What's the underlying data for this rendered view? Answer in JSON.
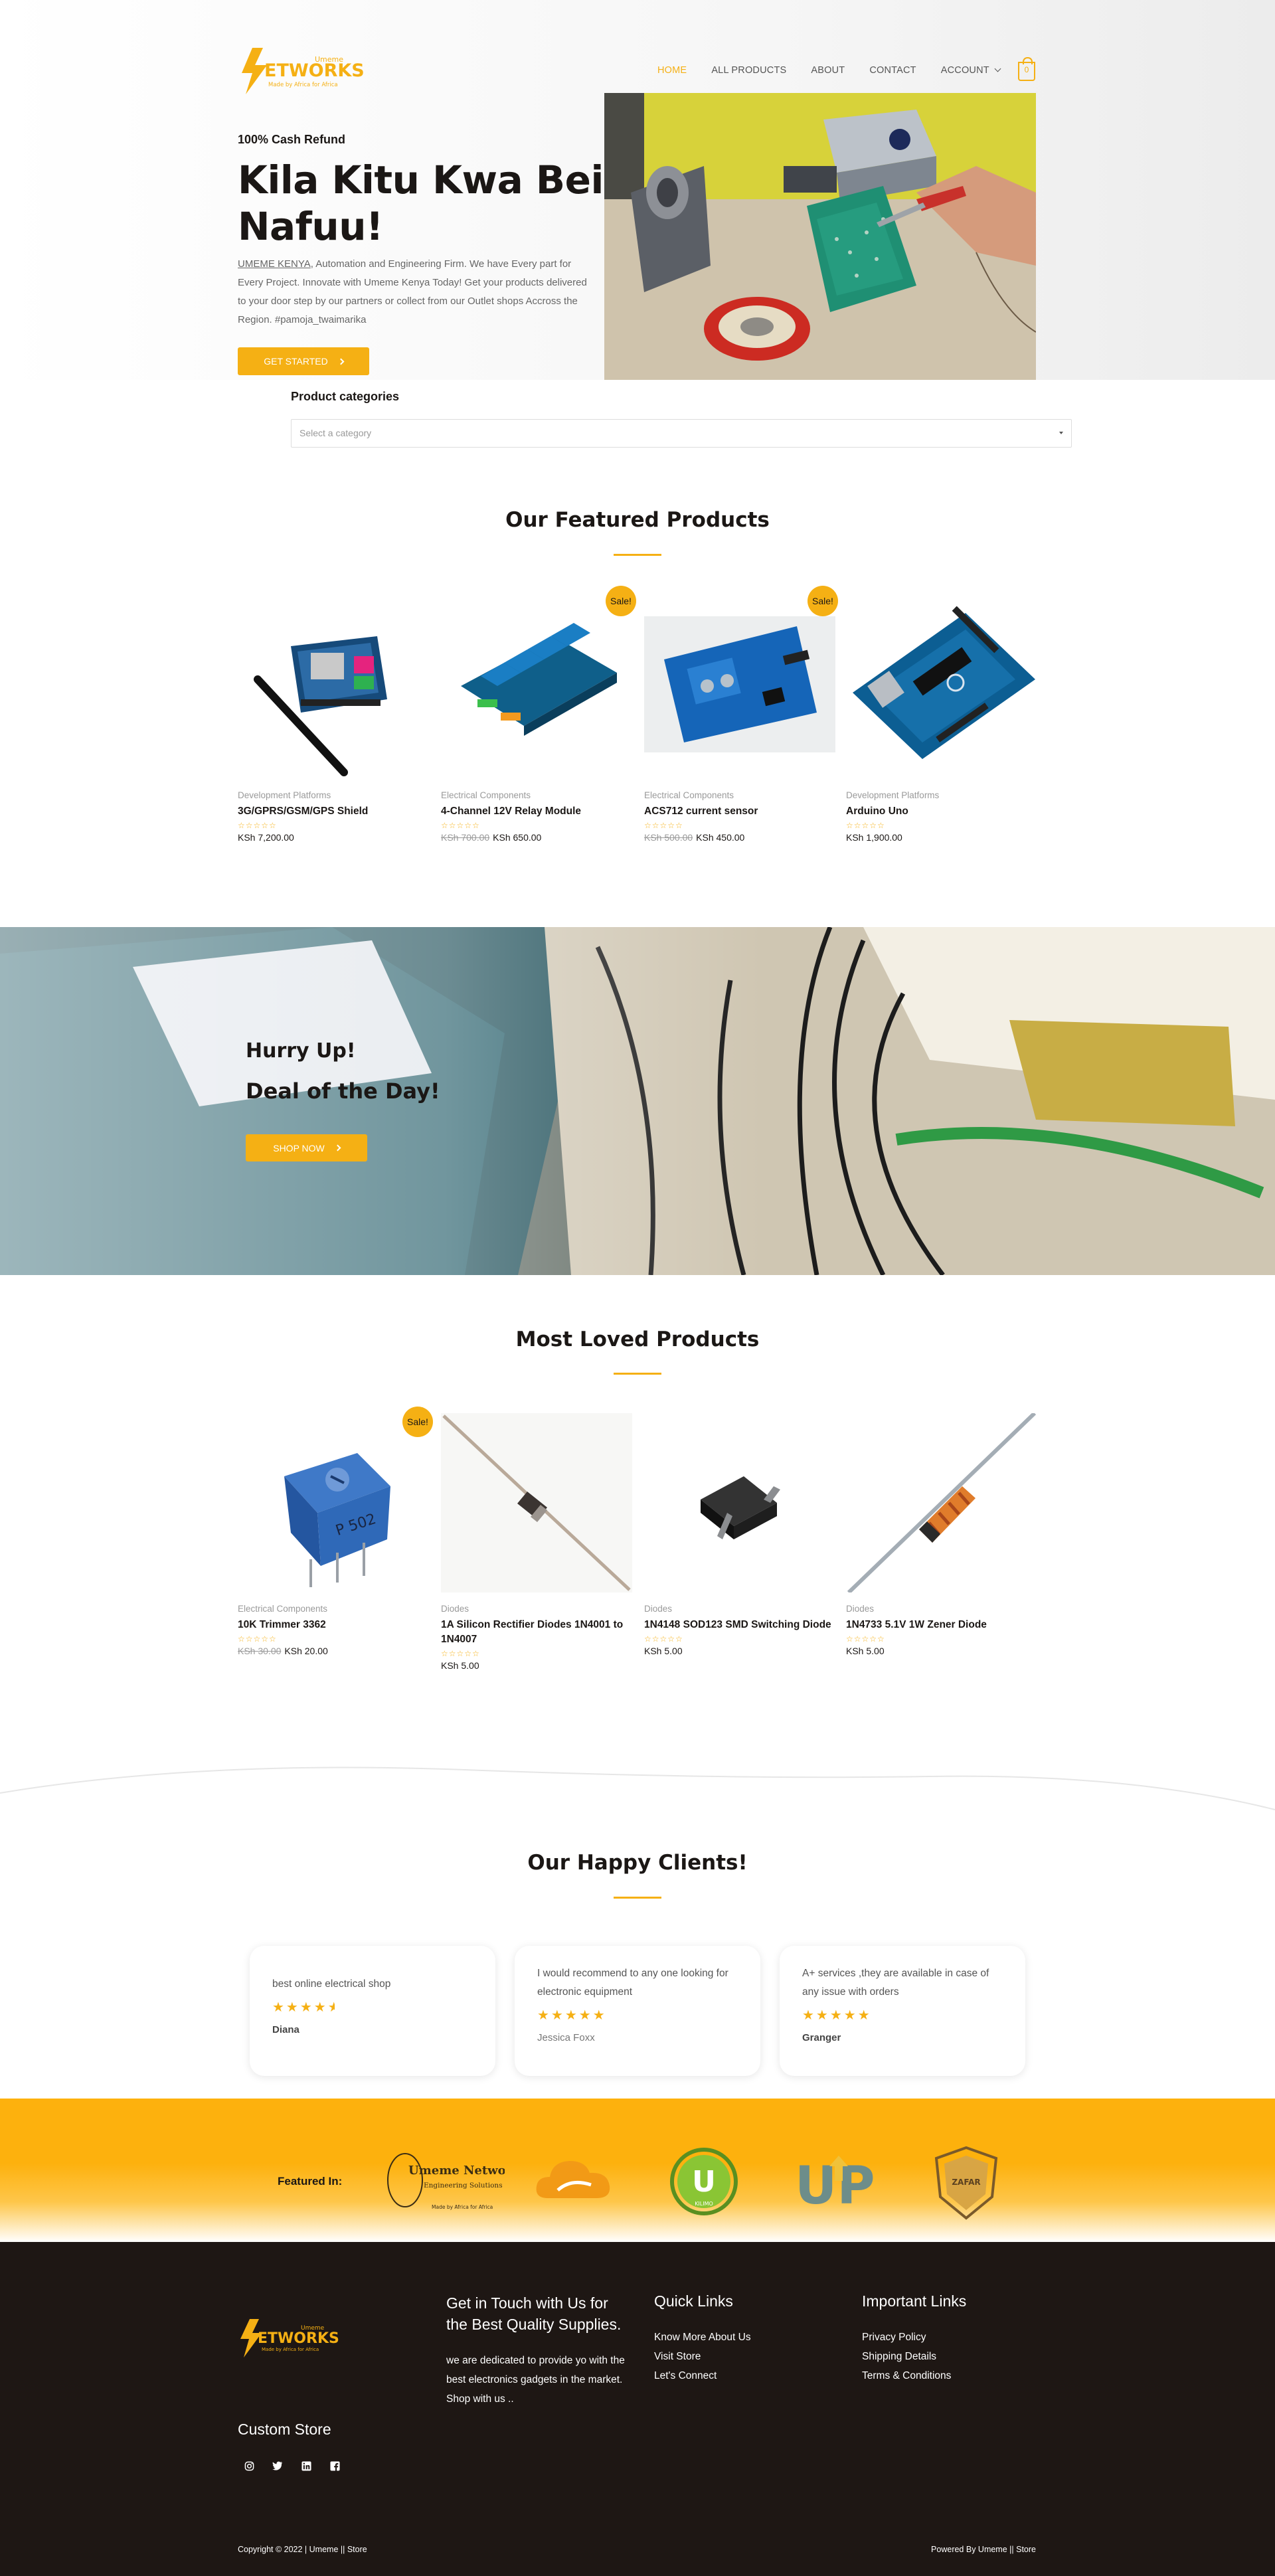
{
  "brand": {
    "logo_main": "ETWORKS",
    "logo_super": "Umeme",
    "logo_tag": "Made by Africa for Africa",
    "accent_color": "#f5b014",
    "dark_color": "#1e1714"
  },
  "nav": {
    "items": [
      {
        "label": "HOME",
        "active": true
      },
      {
        "label": "ALL PRODUCTS"
      },
      {
        "label": "ABOUT"
      },
      {
        "label": "CONTACT"
      },
      {
        "label": "ACCOUNT"
      }
    ],
    "cart_count": "0"
  },
  "hero": {
    "kicker": "100% Cash Refund",
    "title": "Kila Kitu Kwa Bei Nafuu!",
    "desc_link": "UMEME KENYA",
    "desc": ", Automation and Engineering Firm. We have Every part for Every Project. Innovate with Umeme Kenya Today! Get your products delivered to your door step by our partners or collect from our Outlet shops Accross the Region. #pamoja_twaimarika",
    "button": "GET STARTED"
  },
  "categories": {
    "title": "Product categories",
    "placeholder": "Select a category"
  },
  "featured": {
    "title": "Our Featured Products",
    "products": [
      {
        "category": "Development Platforms",
        "name": "3G/GPRS/GSM/GPS Shield",
        "price": "KSh 7,200.00",
        "old_price": "",
        "sale": false,
        "stars": "☆☆☆☆☆"
      },
      {
        "category": "Electrical Components",
        "name": "4-Channel 12V Relay Module",
        "price": "KSh 650.00",
        "old_price": "KSh 700.00",
        "sale": true,
        "sale_label": "Sale!",
        "stars": "☆☆☆☆☆"
      },
      {
        "category": "Electrical Components",
        "name": "ACS712 current sensor",
        "price": "KSh 450.00",
        "old_price": "KSh 500.00",
        "sale": true,
        "sale_label": "Sale!",
        "stars": "☆☆☆☆☆"
      },
      {
        "category": "Development Platforms",
        "name": "Arduino Uno",
        "price": "KSh 1,900.00",
        "old_price": "",
        "sale": false,
        "stars": "☆☆☆☆☆"
      }
    ]
  },
  "deal": {
    "line1": "Hurry Up!",
    "line2": "Deal of the Day!",
    "button": "SHOP NOW"
  },
  "loved": {
    "title": "Most Loved Products",
    "products": [
      {
        "category": "Electrical Components",
        "name": "10K Trimmer 3362",
        "price": "KSh 20.00",
        "old_price": "KSh 30.00",
        "sale": true,
        "sale_label": "Sale!",
        "stars": "☆☆☆☆☆"
      },
      {
        "category": "Diodes",
        "name": "1A Silicon Rectifier Diodes 1N4001 to 1N4007",
        "price": "KSh 5.00",
        "old_price": "",
        "sale": false,
        "stars": "☆☆☆☆☆"
      },
      {
        "category": "Diodes",
        "name": "1N4148 SOD123 SMD Switching Diode",
        "price": "KSh 5.00",
        "old_price": "",
        "sale": false,
        "stars": "☆☆☆☆☆"
      },
      {
        "category": "Diodes",
        "name": "1N4733 5.1V 1W Zener Diode",
        "price": "KSh 5.00",
        "old_price": "",
        "sale": false,
        "stars": "☆☆☆☆☆"
      }
    ]
  },
  "clients": {
    "title": "Our Happy Clients!",
    "testimonials": [
      {
        "text": "best online electrical shop",
        "rating": 4.5,
        "stars": "★★★★",
        "name": "Diana"
      },
      {
        "text": "I would recommend to any one looking for electronic equipment",
        "rating": 5,
        "stars": "★★★★★",
        "name": "Jessica Foxx"
      },
      {
        "text": "A+ services ,they are available in case of any issue with orders",
        "rating": 5,
        "stars": "★★★★★",
        "name": "Granger"
      }
    ]
  },
  "featured_in": {
    "label": "Featured In:",
    "logos": [
      {
        "name": "umeme-networks-logo",
        "text": "Umeme Networks",
        "sub": "Engineering Solutions",
        "tag": "Made by Africa for Africa"
      },
      {
        "name": "cloud-logo"
      },
      {
        "name": "u-circle-logo",
        "text": "U",
        "sub": "KILIMO"
      },
      {
        "name": "up-logo",
        "text": "UP"
      },
      {
        "name": "shield-logo",
        "text": "ZAFAR"
      }
    ]
  },
  "footer": {
    "contact_heading": "Get in Touch with Us for the Best Quality Supplies.",
    "contact_text": "we are dedicated to provide yo with the best electronics gadgets in the market. Shop with us ..",
    "quick_heading": "Quick Links",
    "quick_links": [
      "Know More About Us",
      "Visit Store",
      "Let's Connect"
    ],
    "important_heading": "Important Links",
    "important_links": [
      "Privacy Policy",
      "Shipping Details",
      "Terms & Conditions"
    ],
    "custom_store": "Custom Store",
    "copyright": "Copyright © 2022 | Umeme || Store",
    "powered": "Powered By Umeme || Store"
  }
}
